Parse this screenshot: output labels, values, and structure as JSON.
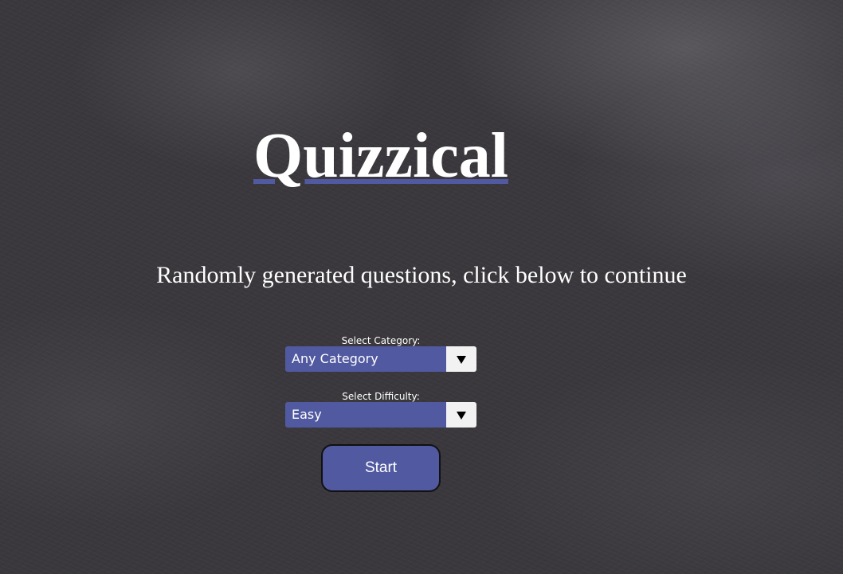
{
  "app": {
    "title": "Quizzical",
    "subtitle": "Randomly generated questions, click below to continue"
  },
  "category": {
    "label": "Select Category:",
    "value": "Any Category"
  },
  "difficulty": {
    "label": "Select Difficulty:",
    "value": "Easy"
  },
  "start_button": {
    "label": "Start"
  },
  "colors": {
    "accent": "#5159a0",
    "background": "#3a383c",
    "text": "#ffffff"
  },
  "icons": {
    "dropdown": "chevron-down-icon"
  }
}
